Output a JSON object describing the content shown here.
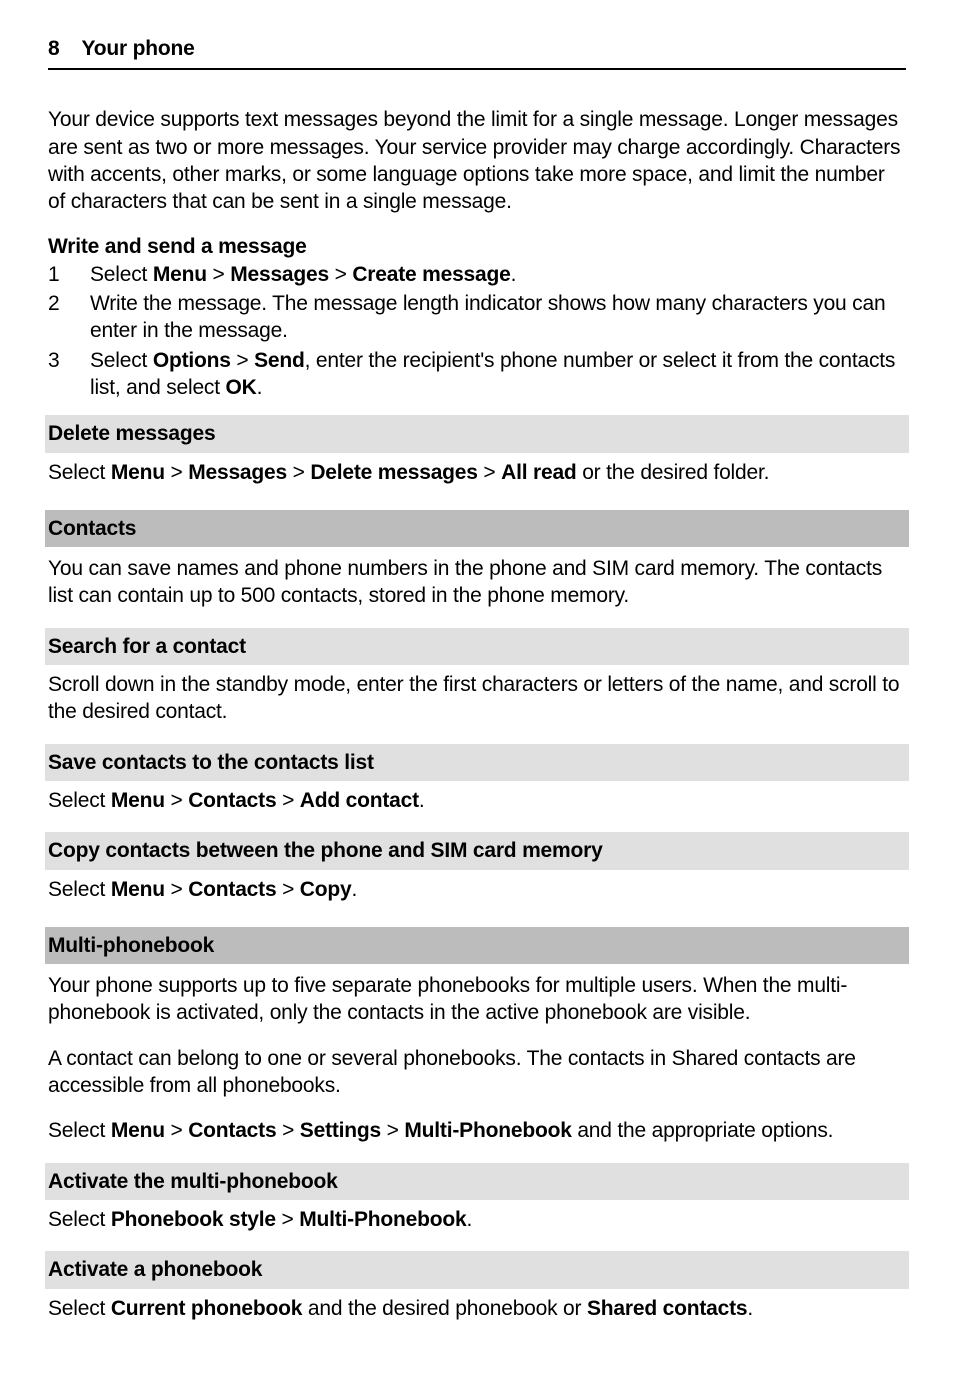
{
  "header": {
    "page_number": "8",
    "title": "Your phone"
  },
  "intro_para": "Your device supports text messages beyond the limit for a single message. Longer messages are sent as two or more messages. Your service provider may charge accordingly. Characters with accents, other marks, or some language options take more space, and limit the number of characters that can be sent in a single message.",
  "write_send": {
    "heading": "Write and send a message",
    "steps": [
      {
        "runs": [
          {
            "t": "Select ",
            "b": false
          },
          {
            "t": "Menu",
            "b": true
          },
          {
            "t": " > ",
            "b": false
          },
          {
            "t": "Messages",
            "b": true
          },
          {
            "t": " > ",
            "b": false
          },
          {
            "t": "Create message",
            "b": true
          },
          {
            "t": ".",
            "b": false
          }
        ]
      },
      {
        "runs": [
          {
            "t": "Write the message. The message length indicator shows how many characters you can enter in the message.",
            "b": false
          }
        ]
      },
      {
        "runs": [
          {
            "t": "Select ",
            "b": false
          },
          {
            "t": "Options",
            "b": true
          },
          {
            "t": " > ",
            "b": false
          },
          {
            "t": "Send",
            "b": true
          },
          {
            "t": ", enter the recipient's phone number or select it from the contacts list, and select ",
            "b": false
          },
          {
            "t": "OK",
            "b": true
          },
          {
            "t": ".",
            "b": false
          }
        ]
      }
    ]
  },
  "delete_msgs": {
    "heading": "Delete messages",
    "runs": [
      {
        "t": "Select ",
        "b": false
      },
      {
        "t": "Menu",
        "b": true
      },
      {
        "t": " > ",
        "b": false
      },
      {
        "t": "Messages",
        "b": true
      },
      {
        "t": " > ",
        "b": false
      },
      {
        "t": "Delete messages",
        "b": true
      },
      {
        "t": " > ",
        "b": false
      },
      {
        "t": "All read",
        "b": true
      },
      {
        "t": " or the desired folder.",
        "b": false
      }
    ]
  },
  "contacts": {
    "heading": "Contacts",
    "intro": "You can save names and phone numbers in the phone and SIM card memory. The contacts list can contain up to 500 contacts, stored in the phone memory.",
    "search": {
      "heading": "Search for a contact",
      "text": "Scroll down in the standby mode, enter the first characters or letters of the name, and scroll to the desired contact."
    },
    "save": {
      "heading": "Save contacts to the contacts list",
      "runs": [
        {
          "t": "Select ",
          "b": false
        },
        {
          "t": "Menu",
          "b": true
        },
        {
          "t": " > ",
          "b": false
        },
        {
          "t": "Contacts",
          "b": true
        },
        {
          "t": " > ",
          "b": false
        },
        {
          "t": "Add contact",
          "b": true
        },
        {
          "t": ".",
          "b": false
        }
      ]
    },
    "copy": {
      "heading": "Copy contacts between the phone and SIM card memory",
      "runs": [
        {
          "t": "Select ",
          "b": false
        },
        {
          "t": "Menu",
          "b": true
        },
        {
          "t": " > ",
          "b": false
        },
        {
          "t": "Contacts",
          "b": true
        },
        {
          "t": " > ",
          "b": false
        },
        {
          "t": "Copy",
          "b": true
        },
        {
          "t": ".",
          "b": false
        }
      ]
    }
  },
  "multi_pb": {
    "heading": "Multi-phonebook",
    "p1": "Your phone supports up to five separate phonebooks for multiple users. When the multi-phonebook is activated, only the contacts in the active phonebook are visible.",
    "p2": "A contact can belong to one or several phonebooks. The contacts in Shared contacts are accessible from all phonebooks.",
    "p3_runs": [
      {
        "t": "Select ",
        "b": false
      },
      {
        "t": "Menu",
        "b": true
      },
      {
        "t": " > ",
        "b": false
      },
      {
        "t": "Contacts",
        "b": true
      },
      {
        "t": " > ",
        "b": false
      },
      {
        "t": "Settings",
        "b": true
      },
      {
        "t": " > ",
        "b": false
      },
      {
        "t": "Multi-Phonebook",
        "b": true
      },
      {
        "t": " and the appropriate options.",
        "b": false
      }
    ],
    "activate_mpb": {
      "heading": "Activate the multi-phonebook",
      "runs": [
        {
          "t": "Select ",
          "b": false
        },
        {
          "t": "Phonebook style",
          "b": true
        },
        {
          "t": " > ",
          "b": false
        },
        {
          "t": "Multi-Phonebook",
          "b": true
        },
        {
          "t": ".",
          "b": false
        }
      ]
    },
    "activate_pb": {
      "heading": "Activate a phonebook",
      "runs": [
        {
          "t": "Select ",
          "b": false
        },
        {
          "t": "Current phonebook",
          "b": true
        },
        {
          "t": " and the desired phonebook or ",
          "b": false
        },
        {
          "t": "Shared contacts",
          "b": true
        },
        {
          "t": ".",
          "b": false
        }
      ]
    }
  }
}
